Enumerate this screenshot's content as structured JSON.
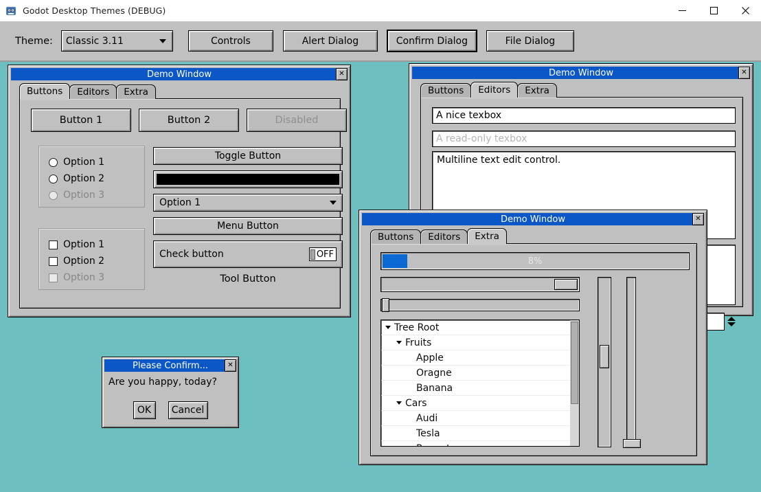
{
  "app": {
    "title": "Godot Desktop Themes (DEBUG)",
    "icon": "godot-robot-icon",
    "window_controls": {
      "minimize": "minimize-icon",
      "maximize": "maximize-icon",
      "close": "close-icon"
    },
    "desktop_background": "#6cbfbe"
  },
  "toolbar": {
    "theme_label": "Theme:",
    "theme_value": "Classic 3.11",
    "theme_options": [
      "Classic 3.11"
    ],
    "buttons": [
      {
        "label": "Controls",
        "focused": false
      },
      {
        "label": "Alert Dialog",
        "focused": false
      },
      {
        "label": "Confirm Dialog",
        "focused": true
      },
      {
        "label": "File Dialog",
        "focused": false
      }
    ]
  },
  "window_buttons": {
    "title": "Demo Window",
    "close_label": "✕",
    "tabs": [
      {
        "label": "Buttons",
        "active": true
      },
      {
        "label": "Editors",
        "active": false
      },
      {
        "label": "Extra",
        "active": false
      }
    ],
    "top_buttons": [
      {
        "label": "Button 1",
        "disabled": false
      },
      {
        "label": "Button 2",
        "disabled": false
      },
      {
        "label": "Disabled",
        "disabled": true
      }
    ],
    "radio_group": [
      {
        "label": "Option 1",
        "disabled": false,
        "checked": false
      },
      {
        "label": "Option 2",
        "disabled": false,
        "checked": false
      },
      {
        "label": "Option 3",
        "disabled": true,
        "checked": false
      }
    ],
    "check_group": [
      {
        "label": "Option 1",
        "disabled": false,
        "checked": false
      },
      {
        "label": "Option 2",
        "disabled": false,
        "checked": false
      },
      {
        "label": "Option 3",
        "disabled": true,
        "checked": false
      }
    ],
    "toggle_button": "Toggle Button",
    "color_picker_value": "#000000",
    "option_button_value": "Option 1",
    "menu_button": "Menu Button",
    "check_button_label": "Check button",
    "check_button_state": "OFF",
    "tool_button": "Tool Button"
  },
  "window_editors": {
    "title": "Demo Window",
    "close_label": "✕",
    "tabs": [
      {
        "label": "Buttons",
        "active": false
      },
      {
        "label": "Editors",
        "active": true
      },
      {
        "label": "Extra",
        "active": false
      }
    ],
    "textbox_value": "A nice texbox",
    "readonly_value": "A read-only texbox",
    "multiline_value": "Multiline text edit control.",
    "spinbox_value": ""
  },
  "window_extra": {
    "title": "Demo Window",
    "close_label": "✕",
    "tabs": [
      {
        "label": "Buttons",
        "active": false
      },
      {
        "label": "Editors",
        "active": false
      },
      {
        "label": "Extra",
        "active": true
      }
    ],
    "progress_label": "8%",
    "progress_value": 8,
    "hscroll_value": 100,
    "hslider_value": 0,
    "vscroll_value": 45,
    "vslider_value": 96,
    "tree": [
      {
        "label": "Tree Root",
        "depth": 0,
        "expandable": true
      },
      {
        "label": "Fruits",
        "depth": 1,
        "expandable": true
      },
      {
        "label": "Apple",
        "depth": 2,
        "expandable": false
      },
      {
        "label": "Oragne",
        "depth": 2,
        "expandable": false
      },
      {
        "label": "Banana",
        "depth": 2,
        "expandable": false
      },
      {
        "label": "Cars",
        "depth": 1,
        "expandable": true
      },
      {
        "label": "Audi",
        "depth": 2,
        "expandable": false
      },
      {
        "label": "Tesla",
        "depth": 2,
        "expandable": false
      },
      {
        "label": "Renaut",
        "depth": 2,
        "expandable": false
      }
    ]
  },
  "confirm_dialog": {
    "title": "Please Confirm...",
    "close_label": "✕",
    "message": "Are you happy, today?",
    "ok_label": "OK",
    "cancel_label": "Cancel"
  }
}
